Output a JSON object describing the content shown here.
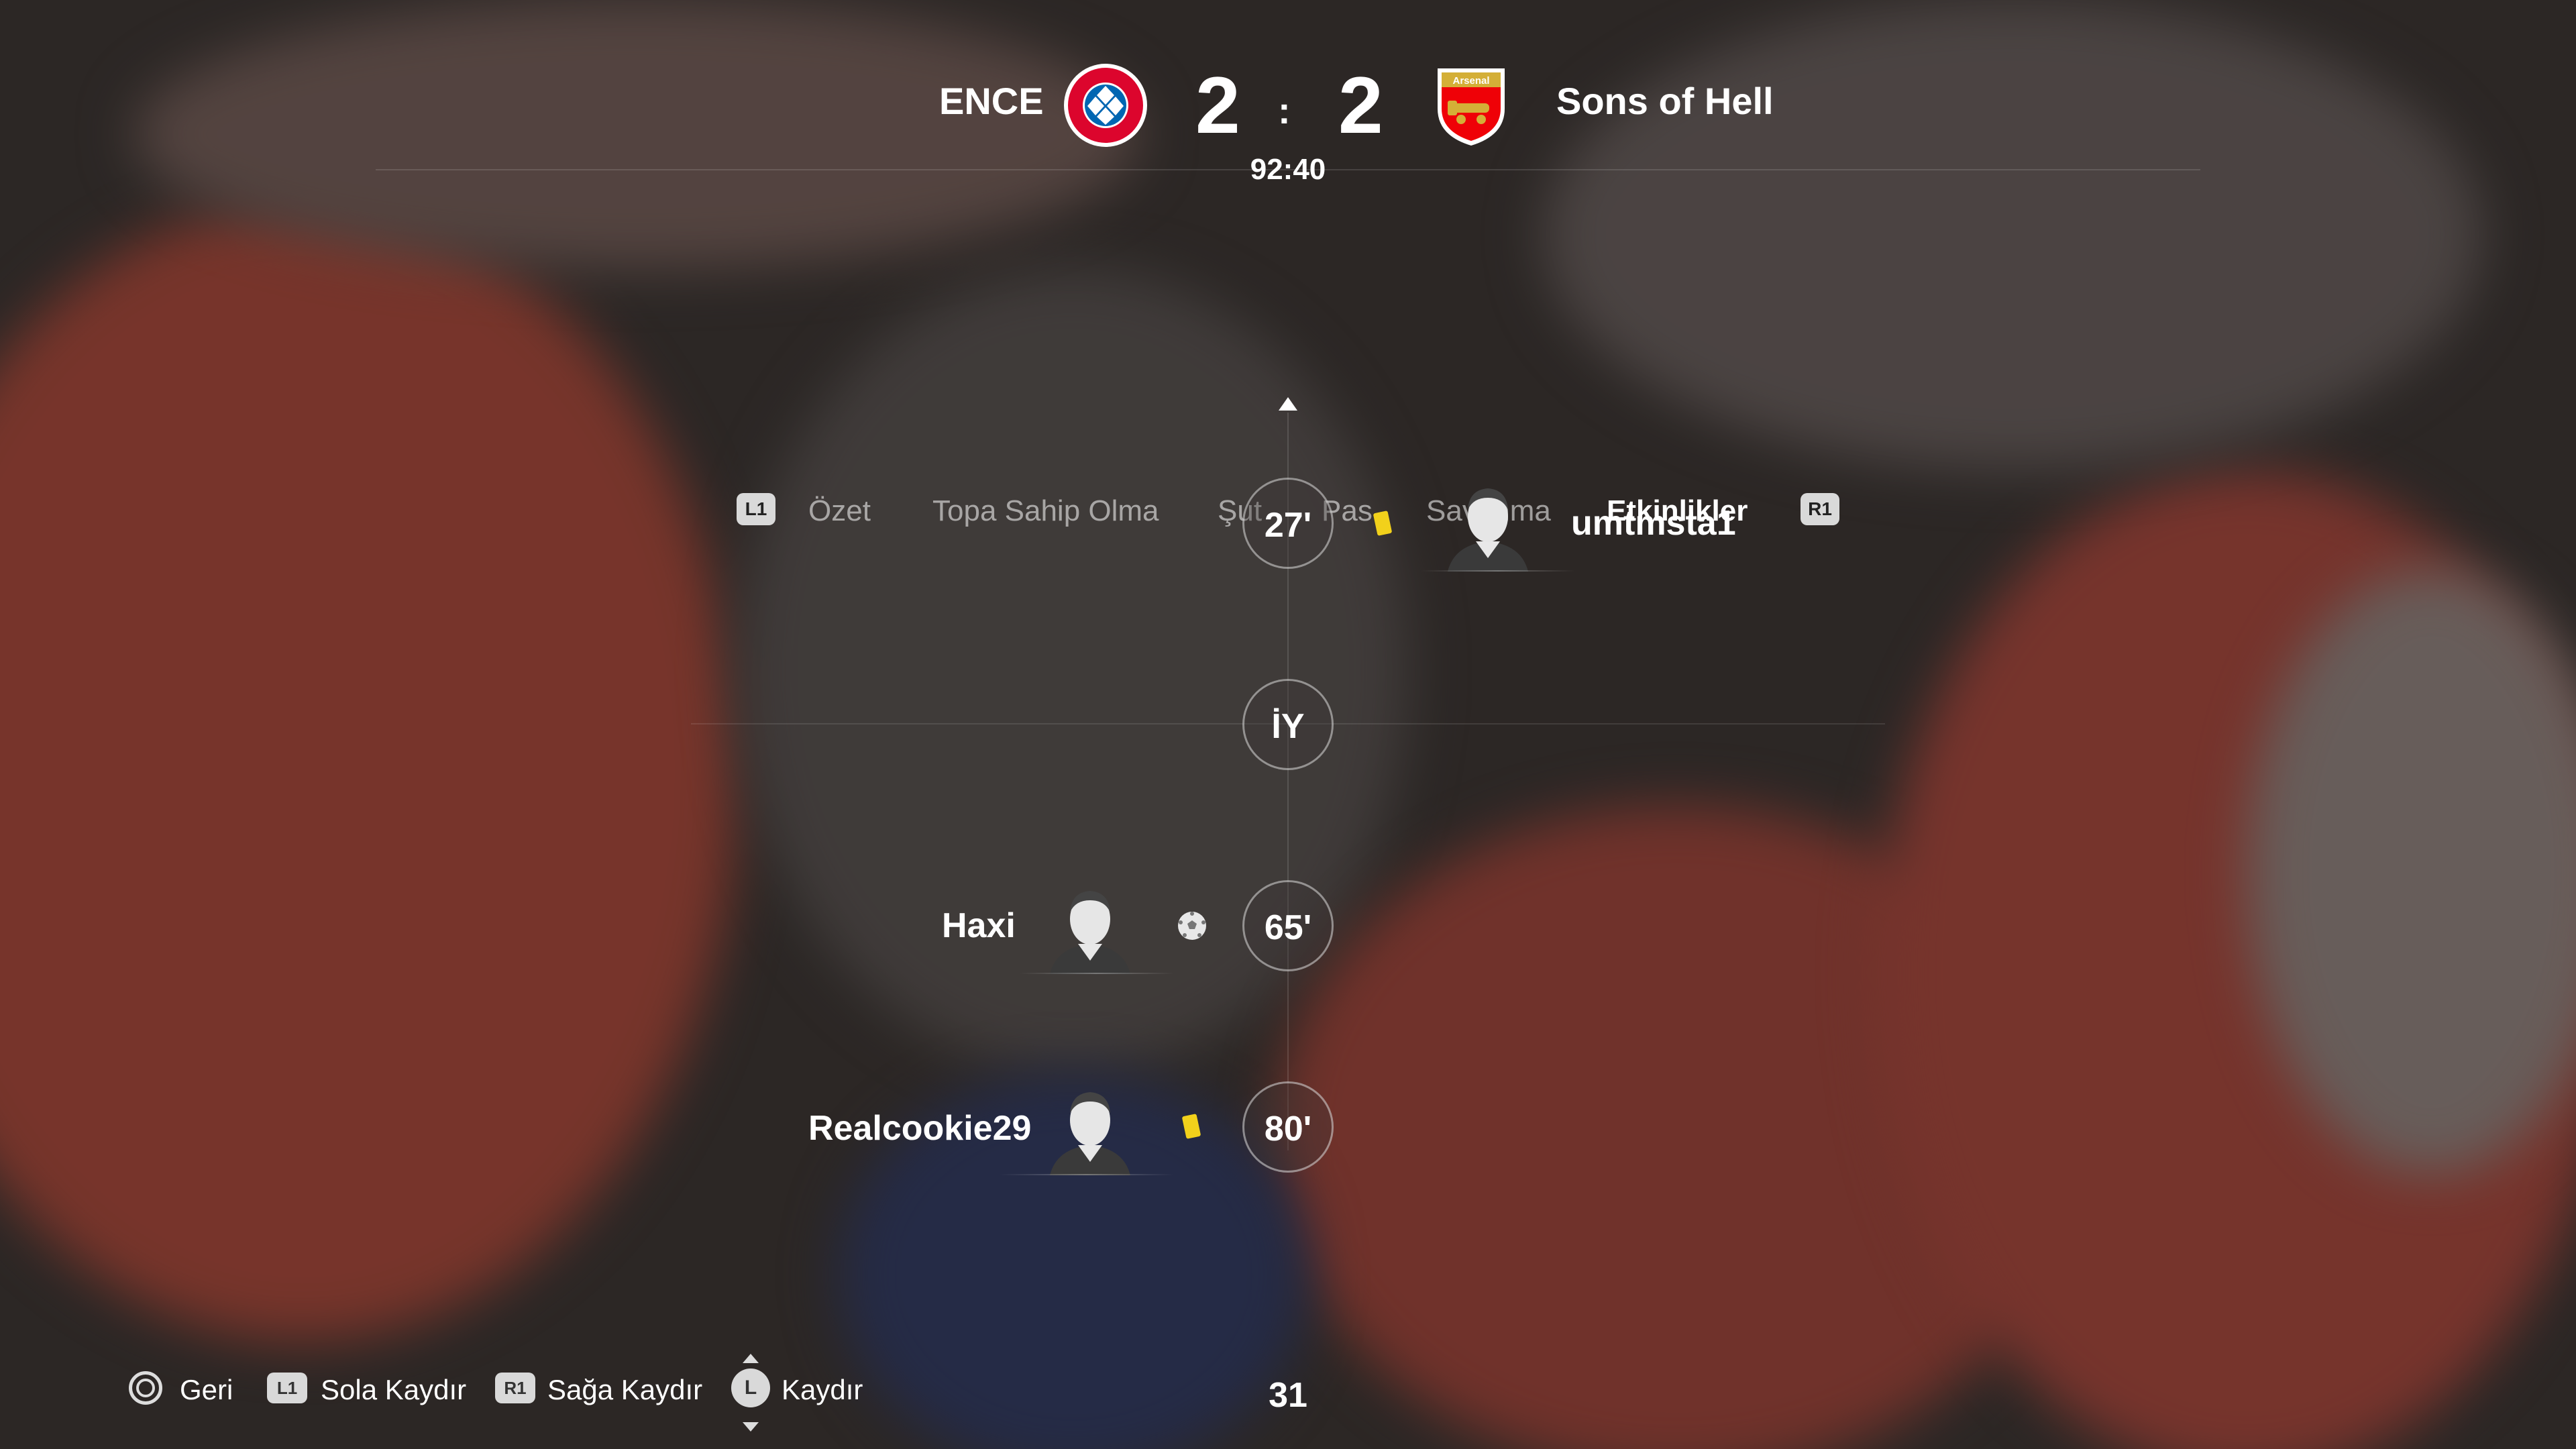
{
  "scoreboard": {
    "home_team": "ENCE",
    "away_team": "Sons of Hell",
    "home_score": "2",
    "away_score": "2",
    "separator": ":",
    "clock": "92:40",
    "home_crest_text": "FC BAYERN MÜNCHEN",
    "away_crest_text": "Arsenal"
  },
  "tabs": {
    "left_shoulder": "L1",
    "right_shoulder": "R1",
    "items": [
      {
        "label": "Özet",
        "active": false
      },
      {
        "label": "Topa Sahip Olma",
        "active": false
      },
      {
        "label": "Şut",
        "active": false
      },
      {
        "label": "Pas",
        "active": false
      },
      {
        "label": "Savunma",
        "active": false
      },
      {
        "label": "Etkinlikler",
        "active": true
      }
    ]
  },
  "events": [
    {
      "minute": "27'",
      "side": "away",
      "type": "yellow-card",
      "player": "umtmsta1"
    },
    {
      "minute": "İY",
      "side": "none",
      "type": "half-time",
      "player": ""
    },
    {
      "minute": "65'",
      "side": "home",
      "type": "goal",
      "player": "Haxi"
    },
    {
      "minute": "80'",
      "side": "home",
      "type": "yellow-card",
      "player": "Realcookie29"
    }
  ],
  "footer": {
    "back_label": "Geri",
    "left_shoulder": "L1",
    "scroll_left_label": "Sola Kaydır",
    "right_shoulder": "R1",
    "scroll_right_label": "Sağa Kaydır",
    "stick": "L",
    "scroll_label": "Kaydır",
    "page_number": "31"
  },
  "colors": {
    "yellow_card": "#f2d11b",
    "bayern_red": "#dc052d",
    "bayern_blue": "#0066b2",
    "arsenal_red": "#ef0107",
    "inactive_tab": "rgba(255,255,255,0.55)"
  }
}
